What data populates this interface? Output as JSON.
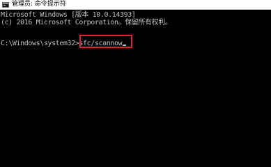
{
  "window": {
    "title": "管理员: 命令提示符",
    "icon": "cmd-console-icon"
  },
  "console": {
    "lines": [
      "Microsoft Windows [版本 10.0.14393]",
      "(c) 2016 Microsoft Corporation。保留所有权利。"
    ],
    "prompt": "C:\\Windows\\system32>",
    "command": "sfc/scannow"
  },
  "colors": {
    "console_bg": "#000000",
    "console_text": "#c0c0c0",
    "highlight_border": "#e0262a",
    "titlebar_bg": "#ffffff"
  }
}
